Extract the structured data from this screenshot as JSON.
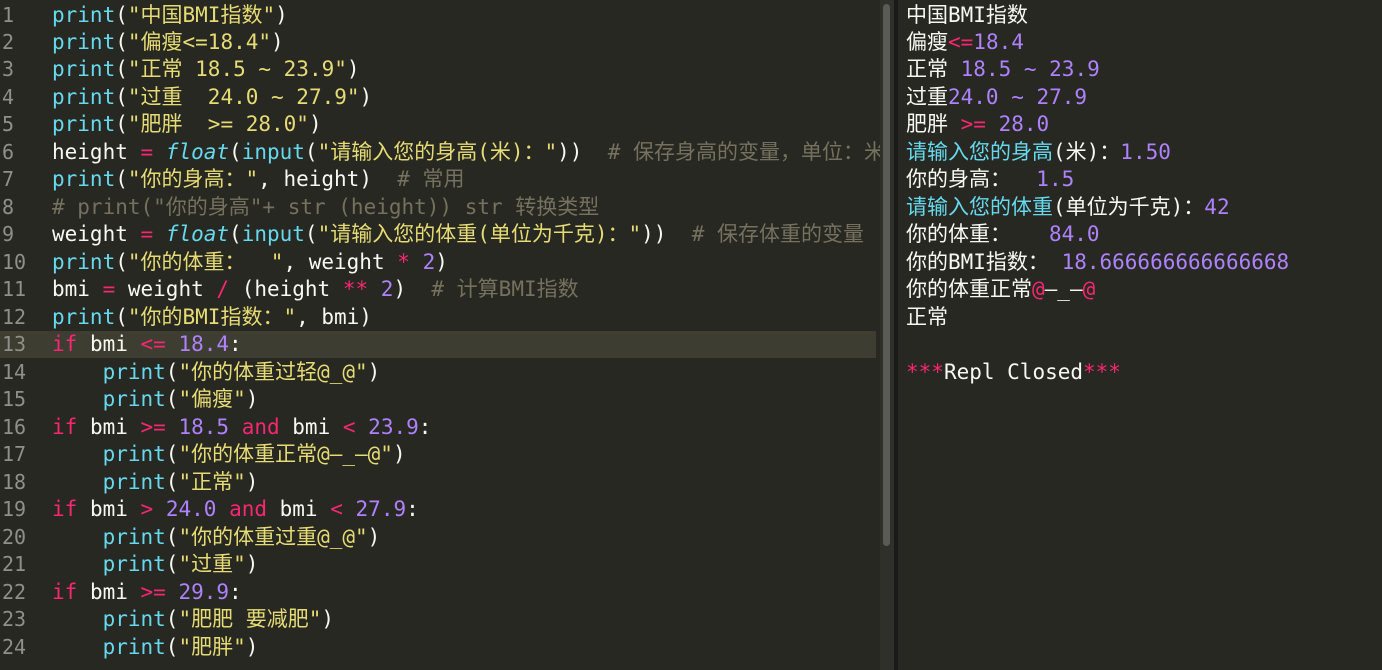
{
  "editor": {
    "line_numbers": [
      "1",
      "2",
      "3",
      "4",
      "5",
      "6",
      "7",
      "8",
      "9",
      "10",
      "11",
      "12",
      "13",
      "14",
      "15",
      "16",
      "17",
      "18",
      "19",
      "20",
      "21",
      "22",
      "23",
      "24"
    ],
    "lines": [
      {
        "print": "print",
        "lp": "(",
        "s": "\"中国BMI指数\"",
        "rp": ")"
      },
      {
        "print": "print",
        "lp": "(",
        "s": "\"偏瘦<=18.4\"",
        "rp": ")"
      },
      {
        "print": "print",
        "lp": "(",
        "s": "\"正常 18.5 ~ 23.9\"",
        "rp": ")"
      },
      {
        "print": "print",
        "lp": "(",
        "s": "\"过重  24.0 ~ 27.9\"",
        "rp": ")"
      },
      {
        "print": "print",
        "lp": "(",
        "s": "\"肥胖  >= 28.0\"",
        "rp": ")"
      },
      {
        "var": "height ",
        "eq": "=",
        "sp": " ",
        "ty": "float",
        "lp1": "(",
        "fn": "input",
        "lp2": "(",
        "s": "\"请输入您的身高(米)：\"",
        "rp": "))",
        "cm": "  # 保存身高的变量，单位：米"
      },
      {
        "print": "print",
        "lp": "(",
        "s": "\"你的身高：\"",
        "rest": ", height)",
        "cm": "  # 常用"
      },
      {
        "cm": "# print(\"你的身高\"+ str (height)) str 转换类型"
      },
      {
        "var": "weight ",
        "eq": "=",
        "sp": " ",
        "ty": "float",
        "lp1": "(",
        "fn": "input",
        "lp2": "(",
        "s": "\"请输入您的体重(单位为千克)：\"",
        "rp": "))",
        "cm": "  # 保存体重的变量"
      },
      {
        "print": "print",
        "lp": "(",
        "s": "\"你的体重：  \"",
        "rest": ", weight ",
        "op": "*",
        "sp": " ",
        "n": "2",
        "rp": ")"
      },
      {
        "var": "bmi ",
        "eq": "=",
        "rest1": " weight ",
        "op": "/",
        "rest2": " (height ",
        "op2": "**",
        "sp": " ",
        "n": "2",
        "rp": ")",
        "cm": "  # 计算BMI指数"
      },
      {
        "print": "print",
        "lp": "(",
        "s": "\"你的BMI指数：\"",
        "rest": ", bmi)"
      },
      {
        "kw": "if",
        "rest": " bmi ",
        "op": "<=",
        "sp": " ",
        "n": "18.4",
        "colon": ":"
      },
      {
        "indent": "    ",
        "print": "print",
        "lp": "(",
        "s": "\"你的体重过轻@_@\"",
        "rp": ")"
      },
      {
        "indent": "    ",
        "print": "print",
        "lp": "(",
        "s": "\"偏瘦\"",
        "rp": ")"
      },
      {
        "kw": "if",
        "rest": " bmi ",
        "op": ">=",
        "sp": " ",
        "n": "18.5",
        "sp2": " ",
        "kw2": "and",
        "rest2": " bmi ",
        "op2": "<",
        "sp3": " ",
        "n2": "23.9",
        "colon": ":"
      },
      {
        "indent": "    ",
        "print": "print",
        "lp": "(",
        "s": "\"你的体重正常@—_—@\"",
        "rp": ")"
      },
      {
        "indent": "    ",
        "print": "print",
        "lp": "(",
        "s": "\"正常\"",
        "rp": ")"
      },
      {
        "kw": "if",
        "rest": " bmi ",
        "op": ">",
        "sp": " ",
        "n": "24.0",
        "sp2": " ",
        "kw2": "and",
        "rest2": " bmi ",
        "op2": "<",
        "sp3": " ",
        "n2": "27.9",
        "colon": ":"
      },
      {
        "indent": "    ",
        "print": "print",
        "lp": "(",
        "s": "\"你的体重过重@_@\"",
        "rp": ")"
      },
      {
        "indent": "    ",
        "print": "print",
        "lp": "(",
        "s": "\"过重\"",
        "rp": ")"
      },
      {
        "kw": "if",
        "rest": " bmi ",
        "op": ">=",
        "sp": " ",
        "n": "29.9",
        "colon": ":"
      },
      {
        "indent": "    ",
        "print": "print",
        "lp": "(",
        "s": "\"肥肥 要减肥\"",
        "rp": ")"
      },
      {
        "indent": "    ",
        "print": "print",
        "lp": "(",
        "s": "\"肥胖\"",
        "rp": ")"
      }
    ]
  },
  "repl": {
    "l1": "中国BMI指数",
    "l2a": "偏瘦",
    "l2b": "<=",
    "l2c": "18.4",
    "l3a": "正常 ",
    "l3b": "18.5 ~ 23.9",
    "l4a": "过重",
    "l4b": "24.0 ~ 27.9",
    "l5a": "肥胖 ",
    "l5b": ">=",
    "l5c": " 28.0",
    "l6a": "请输入您的身高",
    "l6b": "(米)：",
    "l6c": "1.50",
    "l7a": "你的身高：  ",
    "l7b": "1.5",
    "l8a": "请输入您的体重",
    "l8b": "(单位为千克)：",
    "l8c": "42",
    "l9a": "你的体重：   ",
    "l9b": "84.0",
    "l10a": "你的BMI指数： ",
    "l10b": "18.666666666666668",
    "l11a": "你的体重正常",
    "l11b": "@",
    "l11c": "—_—",
    "l11d": "@",
    "l12": "正常",
    "l14a": "***",
    "l14b": "Repl Closed",
    "l14c": "***"
  },
  "colors": {
    "background": "#272822",
    "keyword": "#f92672",
    "string": "#e6db74",
    "number": "#ae81ff",
    "builtin": "#66d9ef",
    "comment": "#75715e"
  }
}
